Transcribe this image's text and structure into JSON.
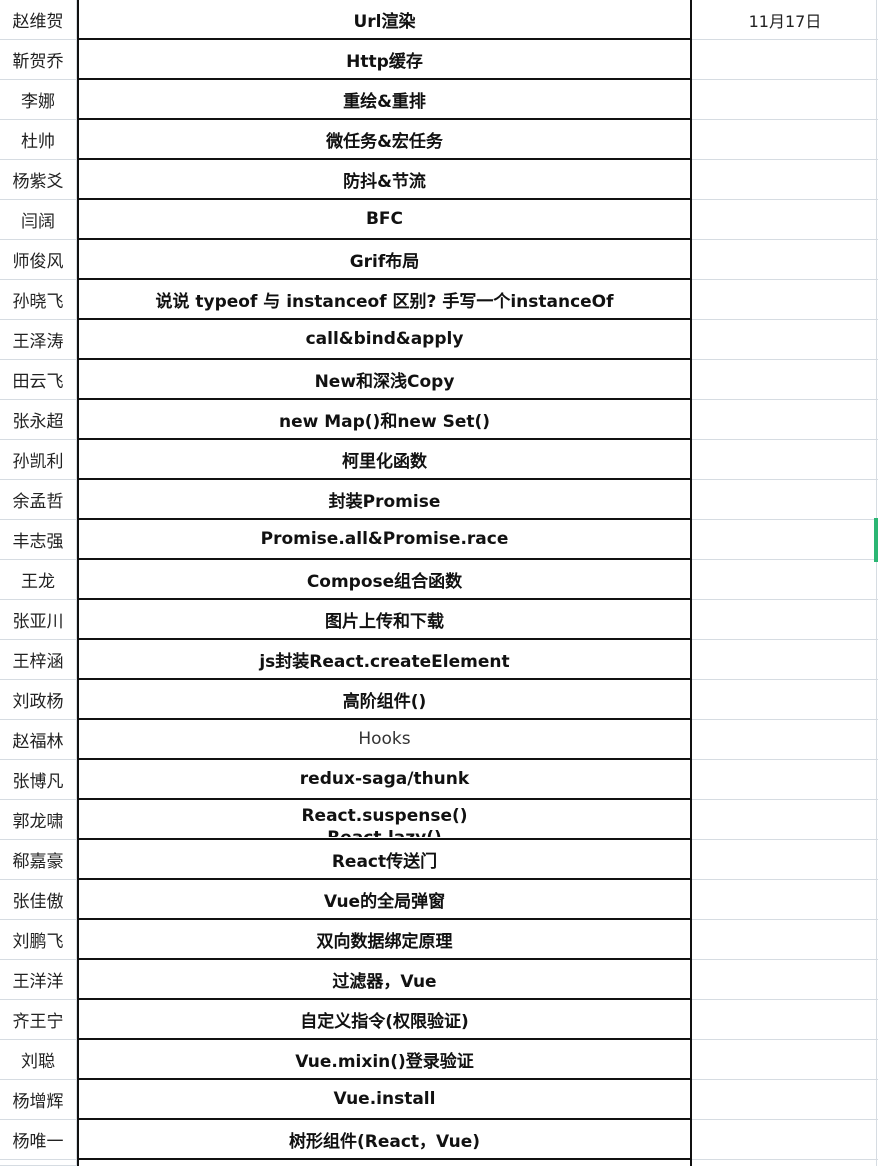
{
  "sheet": {
    "date": "11月17日",
    "accent_color": "#2bb673",
    "rows": [
      {
        "name": "赵维贺",
        "topic": "Url渲染"
      },
      {
        "name": "靳贺乔",
        "topic": "Http缓存"
      },
      {
        "name": "李娜",
        "topic": "重绘&重排"
      },
      {
        "name": "杜帅",
        "topic": "微任务&宏任务"
      },
      {
        "name": "杨紫爻",
        "topic": "防抖&节流"
      },
      {
        "name": "闫阔",
        "topic": "BFC"
      },
      {
        "name": "师俊风",
        "topic": "Grif布局"
      },
      {
        "name": "孙晓飞",
        "topic": "说说 typeof 与 instanceof 区别? 手写一个instanceOf"
      },
      {
        "name": "王泽涛",
        "topic": "call&bind&apply"
      },
      {
        "name": "田云飞",
        "topic": "New和深浅Copy"
      },
      {
        "name": "张永超",
        "topic": "new Map()和new Set()"
      },
      {
        "name": "孙凯利",
        "topic": "柯里化函数"
      },
      {
        "name": "余孟哲",
        "topic": "封装Promise"
      },
      {
        "name": "丰志强",
        "topic": "Promise.all&Promise.race"
      },
      {
        "name": "王龙",
        "topic": "Compose组合函数"
      },
      {
        "name": "张亚川",
        "topic": "图片上传和下载"
      },
      {
        "name": "王梓涵",
        "topic": "js封装React.createElement"
      },
      {
        "name": "刘政杨",
        "topic": "高阶组件()"
      },
      {
        "name": "赵福林",
        "topic": "Hooks"
      },
      {
        "name": "张博凡",
        "topic": "redux-saga/thunk"
      },
      {
        "name": "郭龙啸",
        "topic": "React.suspense()",
        "topic_line2": "React.lazy()"
      },
      {
        "name": "郗嘉豪",
        "topic": "React传送门"
      },
      {
        "name": "张佳傲",
        "topic": "Vue的全局弹窗"
      },
      {
        "name": "刘鹏飞",
        "topic": "双向数据绑定原理"
      },
      {
        "name": "王洋洋",
        "topic": "过滤器，Vue"
      },
      {
        "name": "齐王宁",
        "topic": "自定义指令(权限验证)"
      },
      {
        "name": "刘聪",
        "topic": "Vue.mixin()登录验证"
      },
      {
        "name": "杨增辉",
        "topic": "Vue.install"
      },
      {
        "name": "杨唯一",
        "topic": "树形组件(React，Vue)"
      }
    ]
  }
}
